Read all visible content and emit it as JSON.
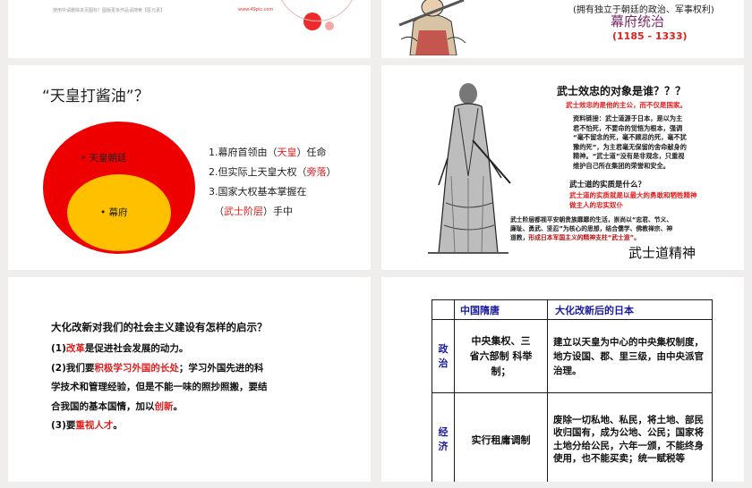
{
  "slide1": {
    "footer_note": "使用中请删除本页图标！图版更多作品请搜索【医元素】",
    "site": "www.49pic.com"
  },
  "slide2": {
    "subtitle": "(拥有独立于朝廷的政治、军事权利)",
    "title": "幕府统治",
    "years": "(1185 - 1333)"
  },
  "slide3": {
    "title": "“天皇打酱油”？",
    "outer_label": "天皇朝廷",
    "inner_label": "幕府",
    "points": {
      "p1_pre": "1.幕府首领由（",
      "p1_red": "天皇",
      "p1_post": "）任命",
      "p2_pre": "2.但实际上天皇大权（",
      "p2_red": "旁落",
      "p2_post": "）",
      "p3": "3.国家大权基本掌握在",
      "p4_pre": "（",
      "p4_red": "武士阶层",
      "p4_post": "）手中"
    }
  },
  "slide4": {
    "question": "武士效忠的对象是谁？？？",
    "answer": "武士效忠的是他的主公，而不仅是国家。",
    "link_lines": [
      "资料链接：武士道源于日本，是以为主",
      "君不怕死，不要命的觉悟为根本，强调",
      "“毫不留念的死，毫不顾忌的死，毫不犹",
      "豫的死”，为主君毫无保留的舍命献身的",
      "精神。“武士道”没有是非观念，只重视",
      "维护自己所在集团的荣誉和安全。"
    ],
    "essence_q": "武士道的实质是什么？",
    "essence_lines": [
      "武士道的实质就是以最大的勇敢和牺牲精神",
      "做主人的忠实奴仆"
    ],
    "bottom_lines": [
      "武士阶层都视平安朝贵族靡靡的生活，崇尚以“忠君、节义、",
      "廉耻、勇武、坚忍”为核心的思想，结合儒学、佛教禅宗、神",
      "道教，形成日本军国主义的精神支柱“武士道”。"
    ],
    "bottom_red": "形成日本军国主义的精神支柱“武士道”。",
    "caption": "武士道精神"
  },
  "slide5": {
    "question": "大化改新对我们的社会主义建设有怎样的启示？",
    "l1_pre": "(1)",
    "l1_red": "改革",
    "l1_post": "是促进社会发展的动力。",
    "l2_pre": "(2)我们要",
    "l2_red": "积极学习外国的长处",
    "l2_post": "；学习外国先进的科",
    "l3": "学技术和管理经验，但是不能一味的照抄照搬，要结",
    "l4_pre": "合我国的基本国情，加以",
    "l4_red": "创新",
    "l4_post": "。",
    "l5_pre": "(3)要",
    "l5_red": "重视人才",
    "l5_post": "。"
  },
  "slide6": {
    "headers": [
      "中国隋唐",
      "大化改新后的日本"
    ],
    "rows": [
      {
        "label": "政治",
        "china": "中央集权、三省六部制 科举制；",
        "japan": "建立以天皇为中心的中央集权制度，地方设国、郡、里三级，由中央派官治理。"
      },
      {
        "label": "经济",
        "china": "实行租庸调制",
        "japan": "废除一切私地、私民，将土地、部民收归国有，成为公地、公民；国家将土地分给公民，六年一颁，不能终身使用，也不能买卖；统一赋税等"
      }
    ]
  },
  "colors": {
    "outer_ellipse": "#ee0000",
    "inner_ellipse": "#ffc000",
    "accent_red": "#e02020",
    "navy": "#1a1aa0",
    "title_purple": "#7a2a6a"
  }
}
